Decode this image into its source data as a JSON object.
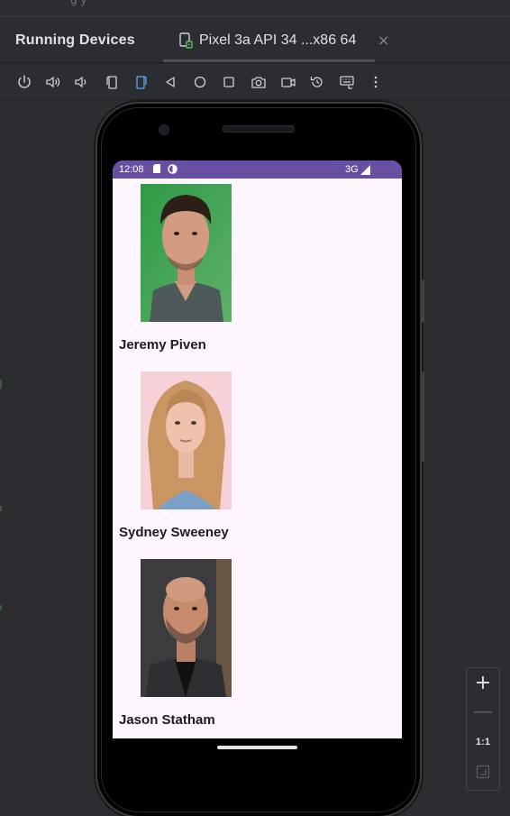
{
  "top_strip": {
    "text": "g             y"
  },
  "header": {
    "title": "Running Devices",
    "tab": {
      "label": "Pixel 3a API 34 ...x86 64",
      "close": "×"
    }
  },
  "toolbar": {
    "buttons": [
      "power-icon",
      "volume-up-icon",
      "volume-down-icon",
      "rotate-left-icon",
      "rotate-right-icon",
      "back-icon",
      "home-icon",
      "overview-icon",
      "screenshot-icon",
      "screen-record-icon",
      "snapshot-icon",
      "keyboard-icon",
      "more-vert-icon"
    ]
  },
  "device": {
    "status_bar": {
      "time": "12:08",
      "network": "3G",
      "background": "#6750a4"
    },
    "screen_background": "#fdf6fe",
    "list": [
      {
        "name": "Jeremy Piven",
        "photo_bg": "#3a9a4e"
      },
      {
        "name": "Sydney Sweeney",
        "photo_bg": "#f5cfd6"
      },
      {
        "name": "Jason Statham",
        "photo_bg": "#6b6b6b"
      }
    ]
  },
  "zoom": {
    "in": "+",
    "out": "—",
    "reset": "1:1"
  },
  "colors": {
    "ide_bg": "#2b2d30",
    "accent": "#6750a4"
  }
}
